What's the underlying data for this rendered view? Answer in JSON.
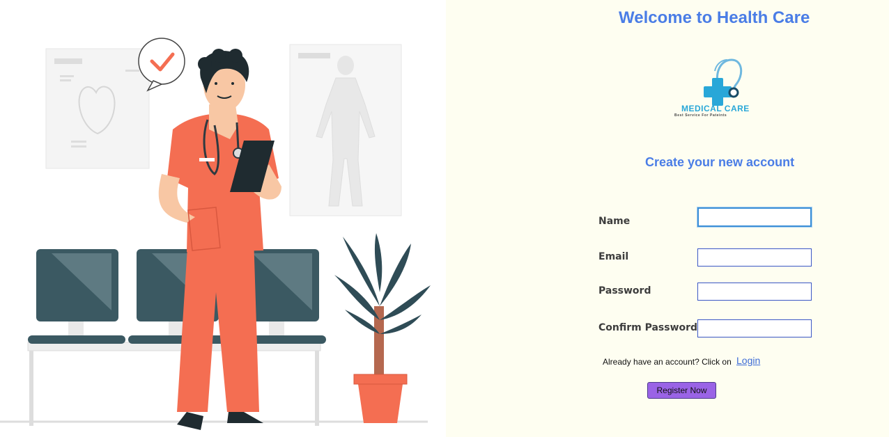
{
  "header": {
    "title": "Welcome to Health Care"
  },
  "logo": {
    "name": "MEDICAL CARE",
    "tagline": "Best Service For Pateints"
  },
  "form": {
    "heading": "Create your new account",
    "fields": [
      {
        "label": "Name",
        "value": ""
      },
      {
        "label": "Email",
        "value": ""
      },
      {
        "label": "Password",
        "value": ""
      },
      {
        "label": "Confirm Password",
        "value": ""
      }
    ],
    "already_text": "Already have an account? Click on",
    "login_link": "Login",
    "submit_label": "Register Now"
  },
  "illustration": {
    "icon": "doctor-illustration"
  },
  "colors": {
    "accent": "#4a7de6",
    "button": "#9a63e6",
    "panel_bg": "#fefef1"
  }
}
